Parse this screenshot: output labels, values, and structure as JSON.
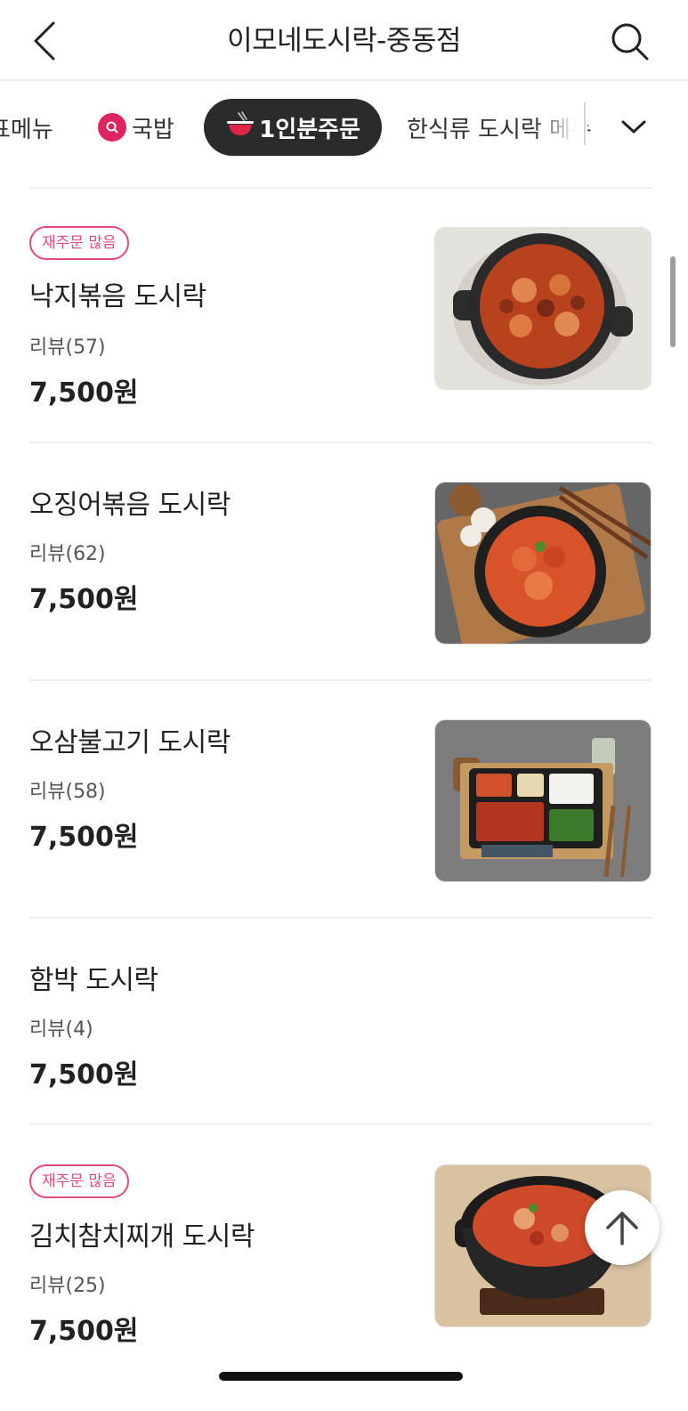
{
  "header": {
    "title": "이모네도시락-중동점",
    "back_icon": "chevron-left-icon",
    "search_icon": "search-icon"
  },
  "tabs": {
    "items": [
      {
        "label": "표메뉴",
        "state": "partial"
      },
      {
        "label": "국밥",
        "icon": "search-icon"
      },
      {
        "label": "1인분주문",
        "icon": "bowl-icon",
        "active": true
      },
      {
        "label": "한식류 도시락 메뉴",
        "state": "partial"
      }
    ],
    "expand_icon": "chevron-down-icon"
  },
  "menu": {
    "items": [
      {
        "badge": "재주문 많음",
        "name": "낙지볶음 도시락",
        "review": "리뷰(57)",
        "price": "7,500원",
        "image": "spicy-octopus-bowl"
      },
      {
        "badge": "",
        "name": "오징어볶음 도시락",
        "review": "리뷰(62)",
        "price": "7,500원",
        "image": "spicy-squid-plate"
      },
      {
        "badge": "",
        "name": "오삼불고기 도시락",
        "review": "리뷰(58)",
        "price": "7,500원",
        "image": "bento-tray"
      },
      {
        "badge": "",
        "name": "함박 도시락",
        "review": "리뷰(4)",
        "price": "7,500원",
        "image": ""
      },
      {
        "badge": "재주문 많음",
        "name": "김치참치찌개 도시락",
        "review": "리뷰(25)",
        "price": "7,500원",
        "image": "kimchi-stew-pot"
      }
    ]
  },
  "floating": {
    "scroll_top_icon": "arrow-up-icon"
  },
  "colors": {
    "accent": "#e24a7c",
    "active_tab_bg": "#2b2b2b",
    "gukbap_dot": "#e0245e"
  }
}
